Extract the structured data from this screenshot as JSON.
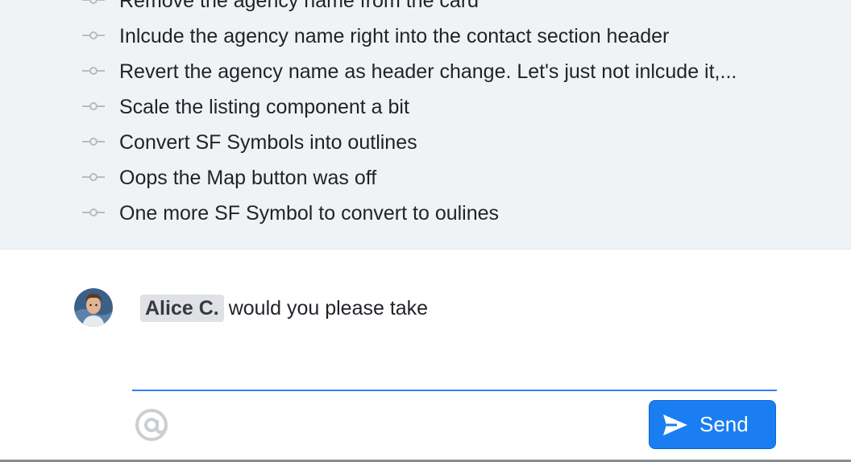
{
  "commits": [
    {
      "message": "Remove the agency name from the card"
    },
    {
      "message": "Inlcude the agency name right into the contact section header"
    },
    {
      "message": "Revert the agency name as header change. Let's just not inlcude it,..."
    },
    {
      "message": "Scale the listing component a bit"
    },
    {
      "message": "Convert SF Symbols into outlines"
    },
    {
      "message": "Oops the Map button was off"
    },
    {
      "message": "One more SF Symbol to convert to oulines"
    }
  ],
  "composer": {
    "mention": "Alice C.",
    "text": "would you please take",
    "send_label": "Send",
    "accent_color": "#1a7ef2"
  },
  "icons": {
    "commit": "commit-node-icon",
    "mention": "at-sign-icon",
    "send": "paper-plane-icon",
    "avatar": "user-avatar"
  }
}
